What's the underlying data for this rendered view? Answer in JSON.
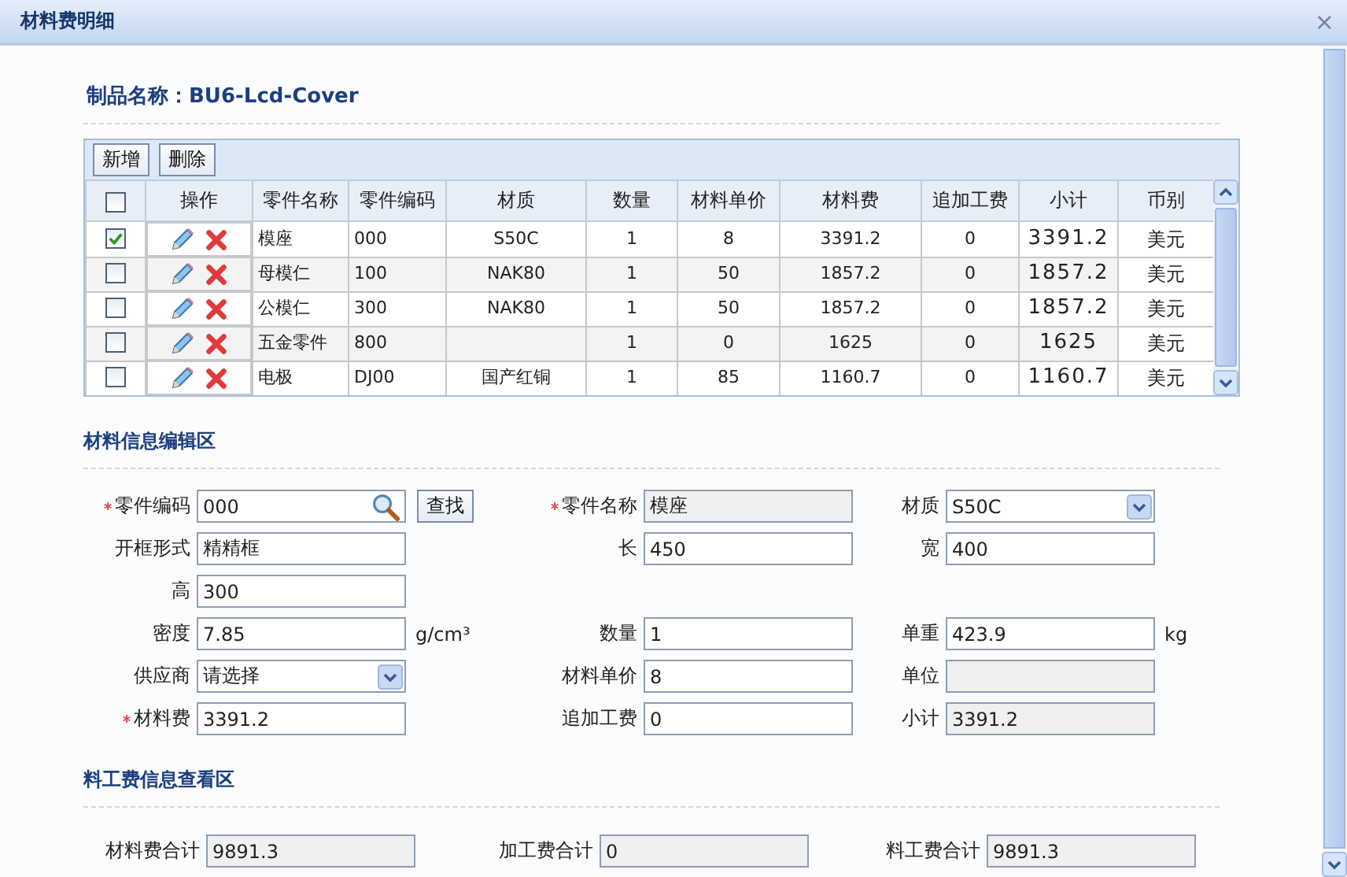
{
  "window": {
    "title": "材料费明细",
    "close": "×"
  },
  "product": "制品名称：BU6-Lcd-Cover",
  "grid": {
    "buttons": [
      "新增",
      "删除"
    ],
    "all_checked": false,
    "columns": [
      "操作",
      "零件名称",
      "零件编码",
      "材质",
      "数量",
      "材料单价",
      "材料费",
      "追加工费",
      "小计",
      "币别"
    ],
    "rows": [
      {
        "checked": true,
        "cells": [
          "",
          "模座",
          "000",
          "S50C",
          "1",
          "8",
          "3391.2",
          "0",
          "3391.2",
          "美元"
        ]
      },
      {
        "checked": false,
        "cells": [
          "",
          "母模仁",
          "100",
          "NAK80",
          "1",
          "50",
          "1857.2",
          "0",
          "1857.2",
          "美元"
        ]
      },
      {
        "checked": false,
        "cells": [
          "",
          "公模仁",
          "300",
          "NAK80",
          "1",
          "50",
          "1857.2",
          "0",
          "1857.2",
          "美元"
        ]
      },
      {
        "checked": false,
        "cells": [
          "",
          "五金零件",
          "800",
          "",
          "1",
          "0",
          "1625",
          "0",
          "1625",
          "美元"
        ]
      },
      {
        "checked": false,
        "cells": [
          "",
          "电极",
          "DJ00",
          "国产红铜",
          "1",
          "85",
          "1160.7",
          "0",
          "1160.7",
          "美元"
        ]
      }
    ]
  },
  "edit_section": {
    "title": "材料信息编辑区",
    "rows": [
      [
        {
          "label": "零件编码",
          "value": "000",
          "kind": "search",
          "required": true,
          "button": "查找"
        },
        {
          "label": "零件名称",
          "value": "模座",
          "kind": "readonly",
          "required": true
        },
        {
          "label": "材质",
          "value": "S50C",
          "kind": "select",
          "required": false
        }
      ],
      [
        {
          "label": "开框形式",
          "value": "精精框",
          "kind": "text",
          "required": false
        },
        {
          "label": "长",
          "value": "450",
          "kind": "text",
          "required": false
        },
        {
          "label": "宽",
          "value": "400",
          "kind": "text",
          "required": false
        }
      ],
      [
        {
          "label": "高",
          "value": "300",
          "kind": "text",
          "required": false
        },
        null,
        null
      ],
      [
        {
          "label": "密度",
          "value": "7.85",
          "kind": "text",
          "required": false,
          "unit": "g/cm³"
        },
        {
          "label": "数量",
          "value": "1",
          "kind": "text",
          "required": false
        },
        {
          "label": "单重",
          "value": "423.9",
          "kind": "text",
          "required": false,
          "unit": "kg"
        }
      ],
      [
        {
          "label": "供应商",
          "value": "请选择",
          "kind": "select",
          "required": false
        },
        {
          "label": "材料单价",
          "value": "8",
          "kind": "text",
          "required": false
        },
        {
          "label": "单位",
          "kind": "readonly",
          "required": false
        }
      ],
      [
        {
          "label": "材料费",
          "value": "3391.2",
          "kind": "text",
          "required": true
        },
        {
          "label": "追加工费",
          "value": "0",
          "kind": "text",
          "required": false
        },
        {
          "label": "小计",
          "value": "3391.2",
          "kind": "readonly",
          "required": false
        }
      ]
    ]
  },
  "summary_section": {
    "title": "料工费信息查看区",
    "fields": [
      {
        "label": "材料费合计",
        "value": "9891.3",
        "kind": "readonly"
      },
      {
        "label": "加工费合计",
        "value": "0",
        "kind": "readonly"
      },
      {
        "label": "料工费合计",
        "value": "9891.3",
        "kind": "readonly"
      }
    ]
  }
}
